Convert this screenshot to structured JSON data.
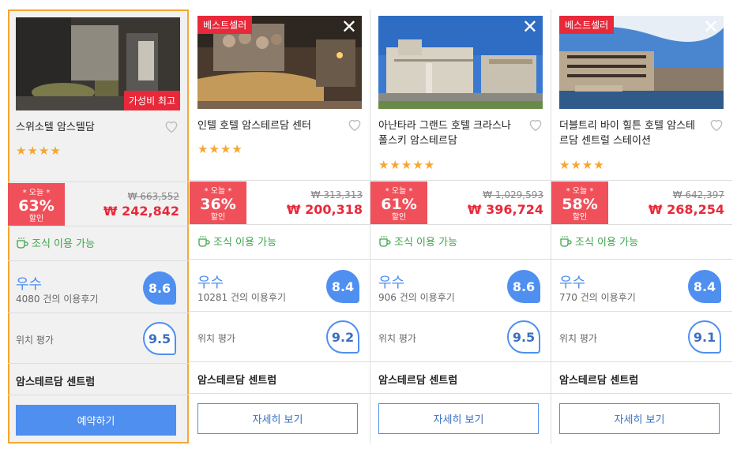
{
  "hotels": [
    {
      "name": "스위소텔 암스텔담",
      "badge": "가성비 최고",
      "stars": "★★★★",
      "today": "* 오늘 *",
      "discount": "63%",
      "discount_label": "할인",
      "original_price": "₩ 663,552",
      "price": "₩ 242,842",
      "breakfast": "조식 이용 가능",
      "grade": "우수",
      "reviews": "4080 건의 이용후기",
      "score": "8.6",
      "location_label": "위치 평가",
      "location_score": "9.5",
      "area": "암스테르담 센트럼",
      "button": "예약하기"
    },
    {
      "name": "인텔 호텔 암스테르담 센터",
      "badge": "베스트셀러",
      "stars": "★★★★",
      "today": "* 오늘 *",
      "discount": "36%",
      "discount_label": "할인",
      "original_price": "₩ 313,313",
      "price": "₩ 200,318",
      "breakfast": "조식 이용 가능",
      "grade": "우수",
      "reviews": "10281 건의 이용후기",
      "score": "8.4",
      "location_label": "위치 평가",
      "location_score": "9.2",
      "area": "암스테르담 센트럼",
      "button": "자세히 보기"
    },
    {
      "name": "아난타라 그랜드 호텔 크라스나폴스키 암스테르담",
      "badge": "",
      "stars": "★★★★★",
      "today": "* 오늘 *",
      "discount": "61%",
      "discount_label": "할인",
      "original_price": "₩ 1,029,593",
      "price": "₩ 396,724",
      "breakfast": "조식 이용 가능",
      "grade": "우수",
      "reviews": "906 건의 이용후기",
      "score": "8.6",
      "location_label": "위치 평가",
      "location_score": "9.5",
      "area": "암스테르담 센트럼",
      "button": "자세히 보기"
    },
    {
      "name": "더블트리 바이 힐튼 호텔 암스테르담 센트럴 스테이션",
      "badge": "베스트셀러",
      "stars": "★★★★",
      "today": "* 오늘 *",
      "discount": "58%",
      "discount_label": "할인",
      "original_price": "₩ 642,397",
      "price": "₩ 268,254",
      "breakfast": "조식 이용 가능",
      "grade": "우수",
      "reviews": "770 건의 이용후기",
      "score": "8.4",
      "location_label": "위치 평가",
      "location_score": "9.1",
      "area": "암스테르담 센트럼",
      "button": "자세히 보기"
    }
  ],
  "close_glyph": "✕",
  "colors": {
    "accent_blue": "#4f8ff0",
    "price_red": "#e8293a",
    "discount_red": "#f0505a",
    "breakfast_green": "#3ea54a",
    "highlight_orange": "#f6a630"
  }
}
